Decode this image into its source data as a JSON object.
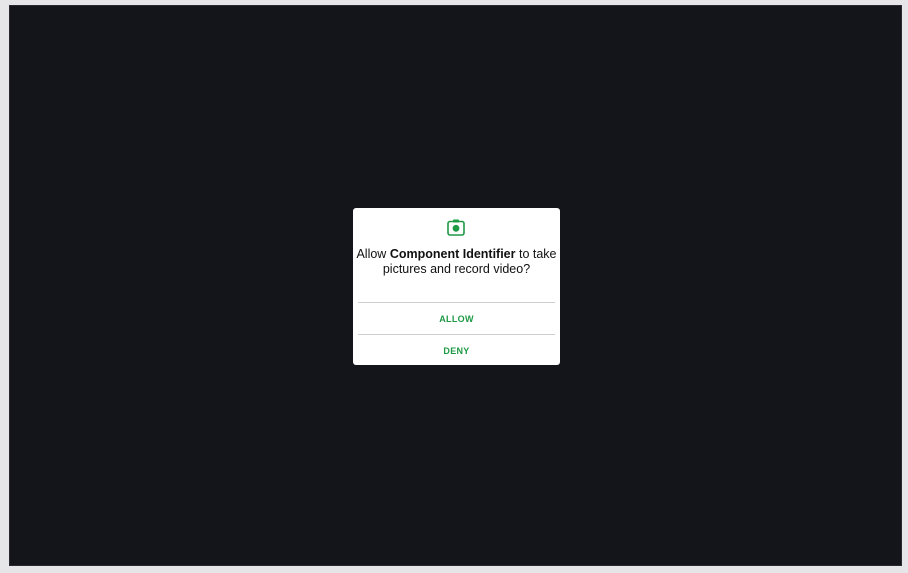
{
  "permission_dialog": {
    "icon": "camera-icon",
    "message_prefix": "Allow ",
    "app_name": "Component Identifier",
    "message_suffix": " to take pictures and record video?",
    "allow_label": "ALLOW",
    "deny_label": "DENY"
  },
  "colors": {
    "background": "#14141b",
    "dialog": "#ffffff",
    "accent": "#1e9a45"
  }
}
